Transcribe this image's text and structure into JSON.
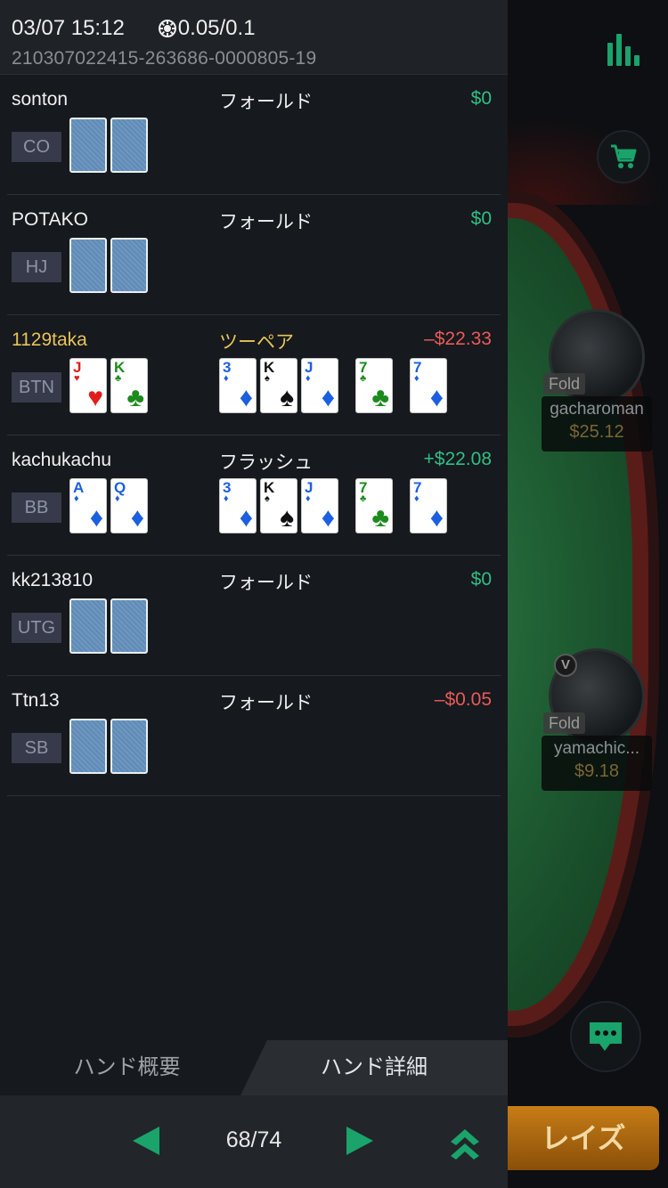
{
  "header": {
    "datetime": "03/07 15:12",
    "stakes": "0.05/0.1",
    "hand_id": "210307022415-263686-0000805-19"
  },
  "players": [
    {
      "name": "sonton",
      "position": "CO",
      "action": "フォールド",
      "result": "$0",
      "result_type": "positive"
    },
    {
      "name": "POTAKO",
      "position": "HJ",
      "action": "フォールド",
      "result": "$0",
      "result_type": "positive"
    },
    {
      "name": "1129taka",
      "position": "BTN",
      "action": "ツーペア",
      "result": "–$22.33",
      "result_type": "negative",
      "hole_cards": [
        {
          "rank": "J",
          "suit": "hearts"
        },
        {
          "rank": "K",
          "suit": "clubs"
        }
      ]
    },
    {
      "name": "kachukachu",
      "position": "BB",
      "action": "フラッシュ",
      "result": "+$22.08",
      "result_type": "positive",
      "hole_cards": [
        {
          "rank": "A",
          "suit": "diamonds"
        },
        {
          "rank": "Q",
          "suit": "diamonds"
        }
      ]
    },
    {
      "name": "kk213810",
      "position": "UTG",
      "action": "フォールド",
      "result": "$0",
      "result_type": "positive"
    },
    {
      "name": "Ttn13",
      "position": "SB",
      "action": "フォールド",
      "result": "–$0.05",
      "result_type": "negative"
    }
  ],
  "board": [
    {
      "rank": "3",
      "suit": "diamonds"
    },
    {
      "rank": "K",
      "suit": "spades"
    },
    {
      "rank": "J",
      "suit": "diamonds"
    },
    {
      "rank": "7",
      "suit": "clubs"
    },
    {
      "rank": "7",
      "suit": "diamonds"
    }
  ],
  "tabs": {
    "summary": "ハンド概要",
    "detail": "ハンド詳細"
  },
  "pagination": {
    "label": "68/74"
  },
  "table": {
    "seats": [
      {
        "name": "gacharoman",
        "stack": "$25.12",
        "status": "Fold"
      },
      {
        "name": "yamachic...",
        "stack": "$9.18",
        "status": "Fold"
      }
    ],
    "raise_label": "レイズ"
  },
  "colors": {
    "positive": "#2fbf86",
    "negative": "#e85a5a",
    "hero": "#e8c35a",
    "accent": "#1aa36b"
  },
  "icons": [
    "chip-icon",
    "stats-icon",
    "cart-icon",
    "chat-icon",
    "prev-arrow-icon",
    "next-arrow-icon",
    "double-chevron-up-icon"
  ]
}
